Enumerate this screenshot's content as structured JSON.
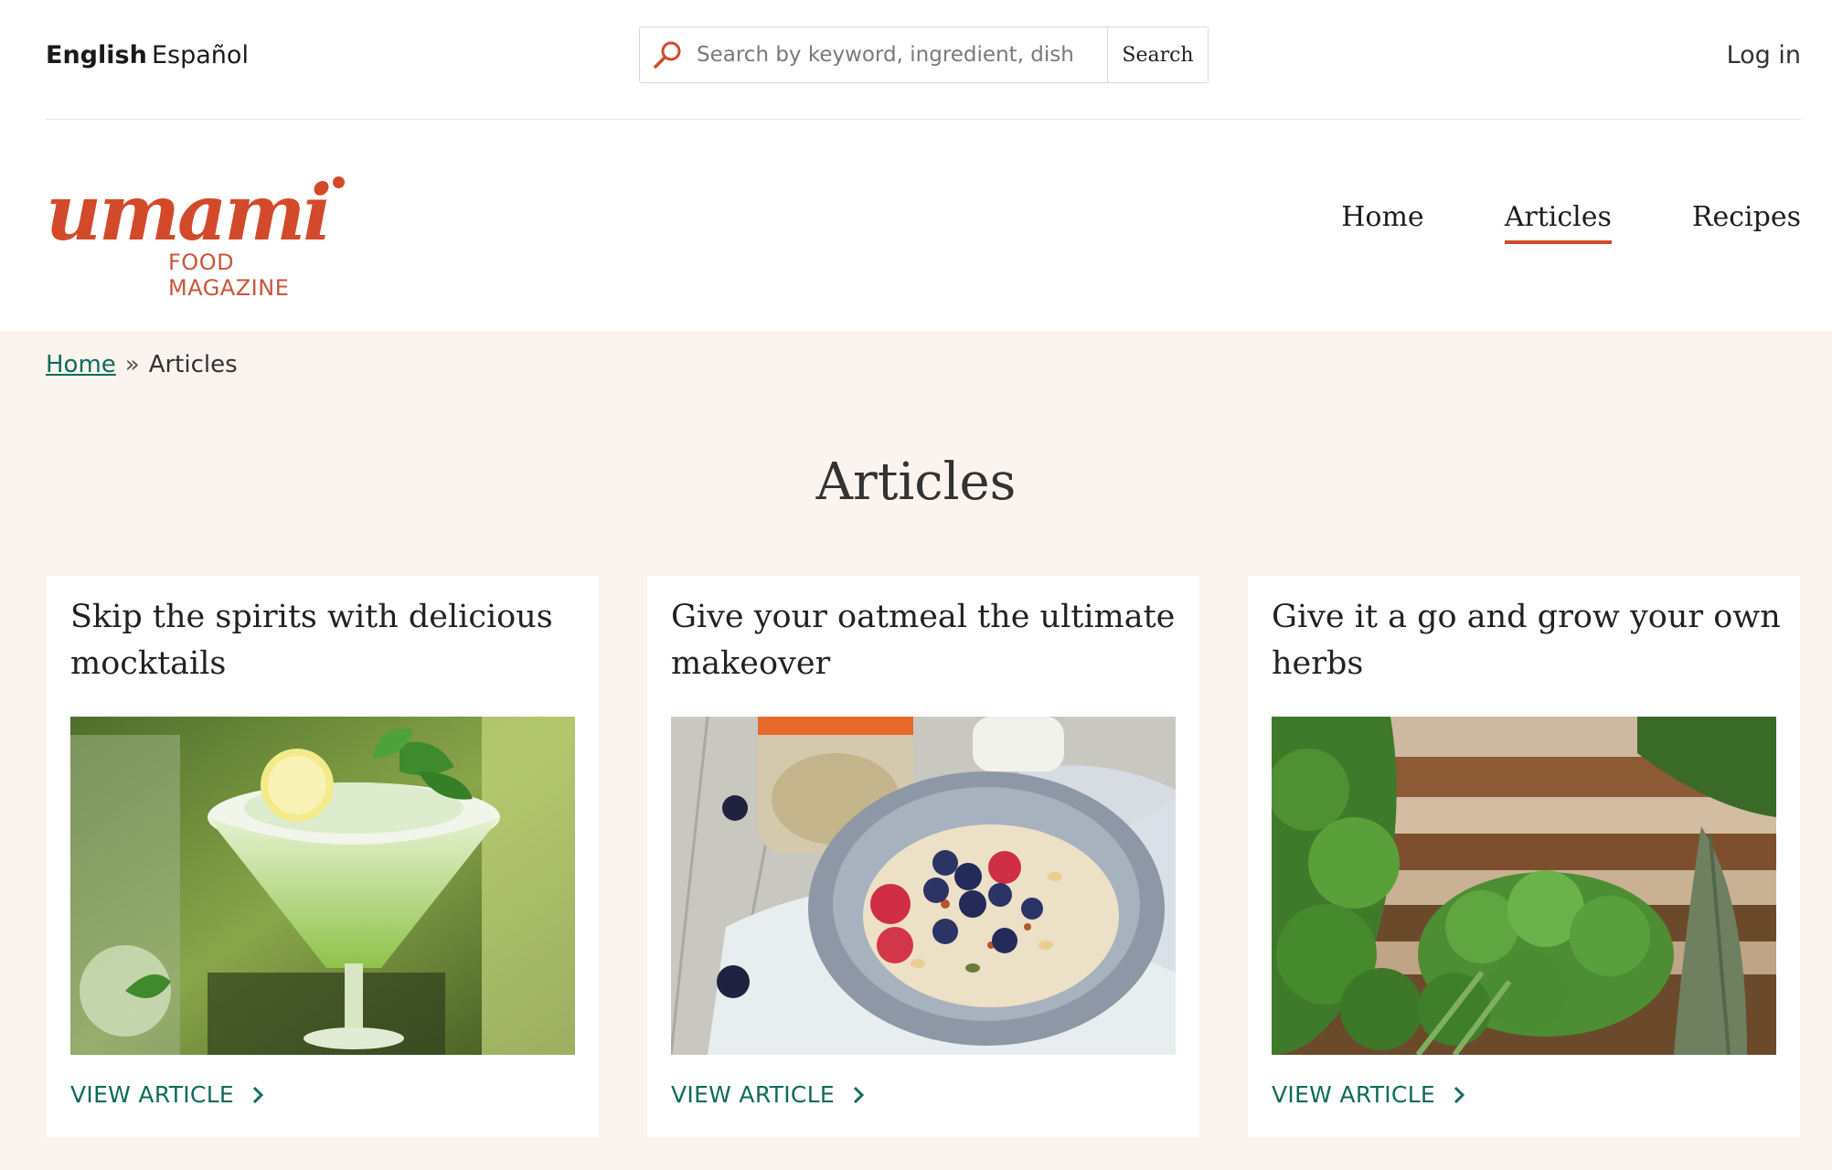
{
  "top_bar": {
    "languages": [
      {
        "label": "English",
        "active": true
      },
      {
        "label": "Español",
        "active": false
      }
    ],
    "search": {
      "placeholder": "Search by keyword, ingredient, dish",
      "button_label": "Search",
      "icon": "search-icon"
    },
    "login_label": "Log in"
  },
  "logo": {
    "wordmark": "umami",
    "tagline": "FOOD MAGAZINE",
    "color": "#d24a2a"
  },
  "nav": {
    "items": [
      {
        "label": "Home",
        "active": false
      },
      {
        "label": "Articles",
        "active": true
      },
      {
        "label": "Recipes",
        "active": false
      }
    ]
  },
  "breadcrumb": {
    "home_label": "Home",
    "separator": "»",
    "current": "Articles"
  },
  "page": {
    "title": "Articles"
  },
  "articles": [
    {
      "title": "Skip the spirits with delicious mocktails",
      "link_label": "VIEW ARTICLE"
    },
    {
      "title": "Give your oatmeal the ultimate makeover",
      "link_label": "VIEW ARTICLE"
    },
    {
      "title": "Give it a go and grow your own herbs",
      "link_label": "VIEW ARTICLE"
    }
  ],
  "colors": {
    "accent": "#d24a2a",
    "link": "#0e6b5a",
    "main_background": "#faf3ee"
  }
}
